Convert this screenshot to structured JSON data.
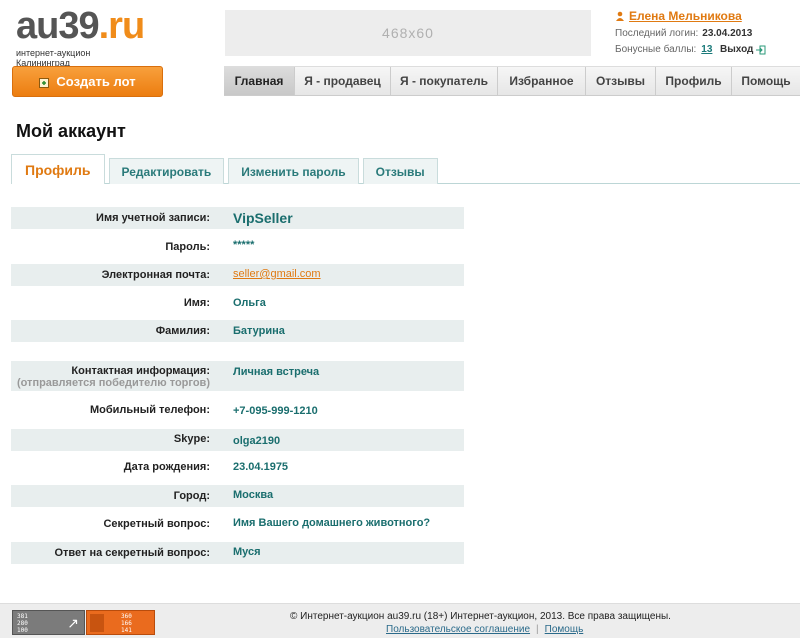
{
  "header": {
    "logo_text": "au39.ru",
    "logo_subtitle": "интернет-аукцион Калининград",
    "banner_text": "468x60",
    "user_name": "Елена Мельникова",
    "last_login_label": "Последний логин:",
    "last_login_value": "23.04.2013",
    "bonus_label": "Бонусные баллы:",
    "bonus_value": "13",
    "logout_label": "Выход"
  },
  "create_lot_label": "Создать лот",
  "nav": [
    {
      "label": "Главная",
      "active": true
    },
    {
      "label": "Я - продавец",
      "active": false
    },
    {
      "label": "Я - покупатель",
      "active": false
    },
    {
      "label": "Избранное",
      "active": false
    },
    {
      "label": "Отзывы",
      "active": false
    },
    {
      "label": "Профиль",
      "active": false
    },
    {
      "label": "Помощь",
      "active": false
    }
  ],
  "page_title": "Мой аккаунт",
  "tabs": [
    {
      "label": "Профиль",
      "active": true
    },
    {
      "label": "Редактировать",
      "active": false
    },
    {
      "label": "Изменить пароль",
      "active": false
    },
    {
      "label": "Отзывы",
      "active": false
    }
  ],
  "fields": [
    {
      "label": "Имя учетной записи:",
      "value": "VipSeller"
    },
    {
      "label": "Пароль:",
      "value": "*****"
    },
    {
      "label": "Электронная почта:",
      "value": "seller@gmail.com"
    },
    {
      "label": "Имя:",
      "value": "Ольга"
    },
    {
      "label": "Фамилия:",
      "value": "Батурина"
    },
    {
      "label": "Контактная информация:",
      "sublabel": "(отправляется победителю торгов)",
      "value": "Личная встреча"
    },
    {
      "label": "Мобильный телефон:",
      "value": "+7-095-999-1210"
    },
    {
      "label": "Skype:",
      "value": "olga2190"
    },
    {
      "label": "Дата рождения:",
      "value": "23.04.1975"
    },
    {
      "label": "Город:",
      "value": "Москва"
    },
    {
      "label": "Секретный вопрос:",
      "value": "Имя Вашего домашнего животного?"
    },
    {
      "label": "Ответ на секретный вопрос:",
      "value": "Муся"
    }
  ],
  "footer": {
    "counter1_lines": [
      "381",
      "280",
      "100"
    ],
    "counter2_lines": [
      "360",
      "166",
      "141"
    ],
    "copyright": "© Интернет-аукцион au39.ru (18+) Интернет-аукцион, 2013. Все права защищены.",
    "links": [
      "Пользовательское соглашение",
      "Помощь"
    ]
  },
  "colors": {
    "accent": "#e07a12",
    "teal": "#1a6e6e",
    "row_shade": "#e8eeee"
  }
}
